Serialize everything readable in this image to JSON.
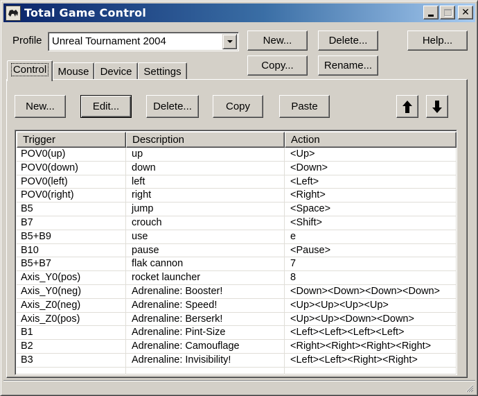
{
  "window": {
    "title": "Total Game Control",
    "icon": "gamepad-icon",
    "caption_buttons": [
      "minimize",
      "maximize",
      "close"
    ],
    "close_glyph": "✕"
  },
  "profile": {
    "label": "Profile",
    "selected": "Unreal Tournament 2004"
  },
  "profile_buttons": {
    "new": "New...",
    "delete": "Delete...",
    "help": "Help...",
    "copy": "Copy...",
    "rename": "Rename..."
  },
  "tabs": [
    {
      "label": "Control",
      "active": true
    },
    {
      "label": "Mouse",
      "active": false
    },
    {
      "label": "Device",
      "active": false
    },
    {
      "label": "Settings",
      "active": false
    }
  ],
  "toolbar": {
    "new": "New...",
    "edit": "Edit...",
    "delete": "Delete...",
    "copy": "Copy",
    "paste": "Paste",
    "move_up_icon": "arrow-up-icon",
    "move_down_icon": "arrow-down-icon"
  },
  "table": {
    "columns": [
      "Trigger",
      "Description",
      "Action"
    ],
    "rows": [
      [
        "POV0(up)",
        "up",
        "<Up>"
      ],
      [
        "POV0(down)",
        "down",
        "<Down>"
      ],
      [
        "POV0(left)",
        "left",
        "<Left>"
      ],
      [
        "POV0(right)",
        "right",
        "<Right>"
      ],
      [
        "B5",
        "jump",
        "<Space>"
      ],
      [
        "B7",
        "crouch",
        "<Shift>"
      ],
      [
        "B5+B9",
        "use",
        "e"
      ],
      [
        "B10",
        "pause",
        "<Pause>"
      ],
      [
        "B5+B7",
        "flak cannon",
        "7"
      ],
      [
        "Axis_Y0(pos)",
        "rocket launcher",
        "8"
      ],
      [
        "Axis_Y0(neg)",
        "Adrenaline: Booster!",
        "<Down><Down><Down><Down>"
      ],
      [
        "Axis_Z0(neg)",
        "Adrenaline: Speed!",
        "<Up><Up><Up><Up>"
      ],
      [
        "Axis_Z0(pos)",
        "Adrenaline: Berserk!",
        "<Up><Up><Down><Down>"
      ],
      [
        "B1",
        "Adrenaline: Pint-Size",
        "<Left><Left><Left><Left>"
      ],
      [
        "B2",
        "Adrenaline: Camouflage",
        "<Right><Right><Right><Right>"
      ],
      [
        "B3",
        "Adrenaline: Invisibility!",
        "<Left><Left><Right><Right>"
      ]
    ]
  },
  "colors": {
    "title_gradient_start": "#0a246a",
    "title_gradient_end": "#a6caf0",
    "face": "#d4d0c8"
  }
}
